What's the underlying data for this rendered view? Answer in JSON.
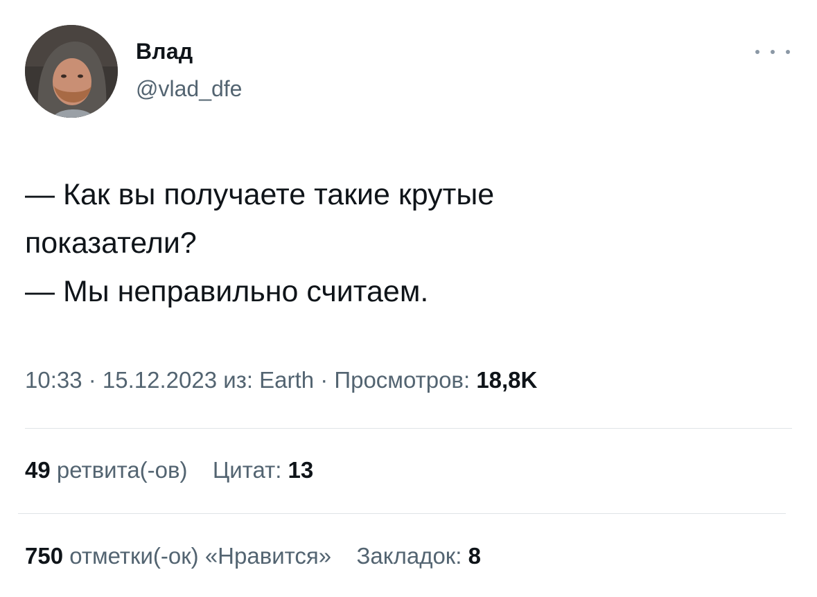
{
  "author": {
    "display_name": "Влад",
    "handle": "@vlad_dfe",
    "avatar_icon": "user-avatar-photo"
  },
  "tweet": {
    "lines": [
      "— Как вы получаете такие крутые",
      "показатели?",
      "— Мы неправильно считаем."
    ]
  },
  "meta": {
    "time": "10:33",
    "separator": " · ",
    "date": "15.12.2023",
    "source_prefix": " из: ",
    "source": "Earth",
    "views_label": "Просмотров: ",
    "views_value": "18,8K"
  },
  "stats": {
    "retweets_count": "49",
    "retweets_label": " ретвита(-ов)",
    "quotes_label": "Цитат: ",
    "quotes_count": "13",
    "likes_count": "750",
    "likes_label": " отметки(-ок) «Нравится»",
    "bookmarks_label": "Закладок: ",
    "bookmarks_count": "8"
  },
  "colors": {
    "text_primary": "#0f1419",
    "text_secondary": "#536471",
    "divider": "#dfe3e6"
  }
}
